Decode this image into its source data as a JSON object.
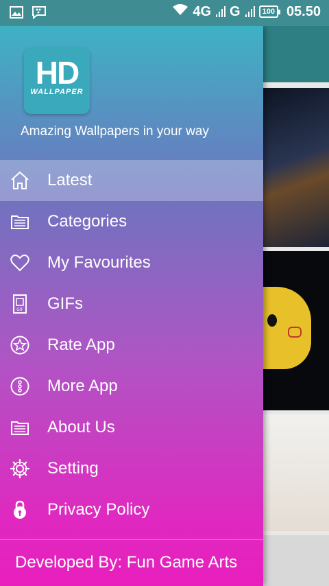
{
  "status_bar": {
    "network_4g": "4G",
    "network_g": "G",
    "battery": "100",
    "time": "05.50"
  },
  "drawer": {
    "logo": {
      "big": "HD",
      "small": "WALLPAPER"
    },
    "tagline": "Amazing Wallpapers in your way",
    "menu": [
      {
        "label": "Latest",
        "icon": "home-icon",
        "active": true
      },
      {
        "label": "Categories",
        "icon": "folder-icon",
        "active": false
      },
      {
        "label": "My Favourites",
        "icon": "heart-icon",
        "active": false
      },
      {
        "label": "GIFs",
        "icon": "gif-icon",
        "active": false
      },
      {
        "label": "Rate App",
        "icon": "star-icon",
        "active": false
      },
      {
        "label": "More App",
        "icon": "more-icon",
        "active": false
      },
      {
        "label": "About Us",
        "icon": "folder-icon",
        "active": false
      },
      {
        "label": "Setting",
        "icon": "gear-icon",
        "active": false
      },
      {
        "label": "Privacy Policy",
        "icon": "lock-icon",
        "active": false
      }
    ],
    "footer": "Developed By: Fun Game Arts"
  },
  "colors": {
    "status_bar": "#3f8c93",
    "drawer_top": "#3eb2c4",
    "drawer_bottom": "#e81fbd",
    "active_highlight": "#ffffff47"
  }
}
